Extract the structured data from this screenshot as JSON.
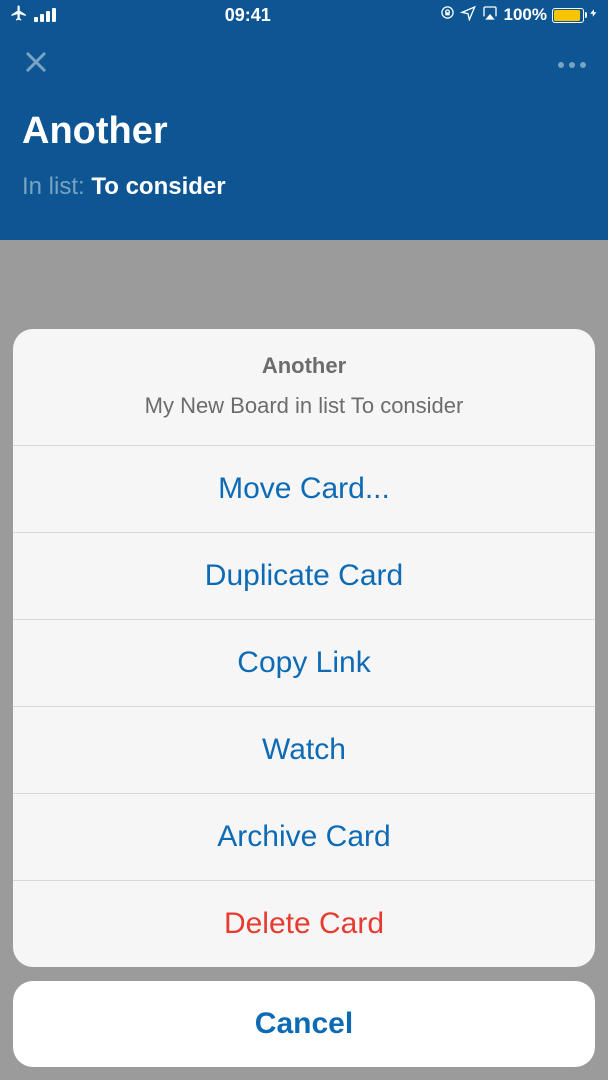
{
  "status": {
    "time": "09:41",
    "battery_text": "100%"
  },
  "header": {
    "card_title": "Another",
    "in_list_prefix": "In list: ",
    "list_name": "To consider"
  },
  "sheet": {
    "title": "Another",
    "subtitle": "My New Board in list To consider",
    "actions": {
      "move": "Move Card...",
      "duplicate": "Duplicate Card",
      "copy_link": "Copy Link",
      "watch": "Watch",
      "archive": "Archive Card",
      "delete": "Delete Card"
    },
    "cancel": "Cancel"
  }
}
